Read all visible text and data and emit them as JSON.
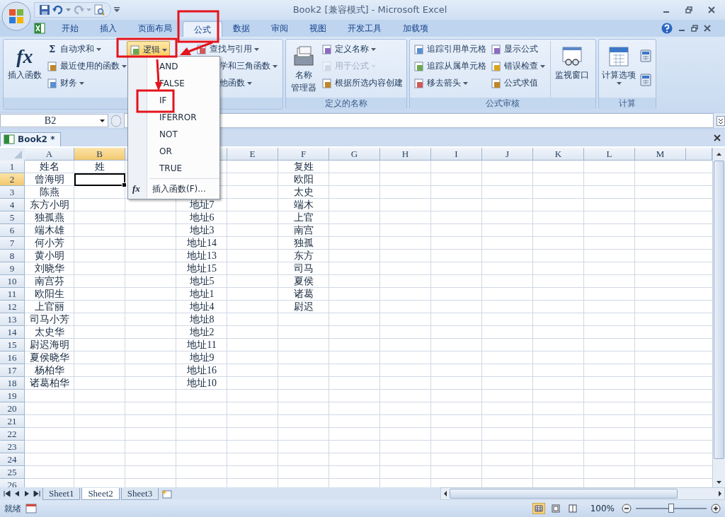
{
  "window": {
    "title": "Book2  [兼容模式] - Microsoft Excel"
  },
  "tabs": [
    {
      "label": "开始",
      "selected": false
    },
    {
      "label": "插入",
      "selected": false
    },
    {
      "label": "页面布局",
      "selected": false
    },
    {
      "label": "公式",
      "selected": true
    },
    {
      "label": "数据",
      "selected": false
    },
    {
      "label": "审阅",
      "selected": false
    },
    {
      "label": "视图",
      "selected": false
    },
    {
      "label": "开发工具",
      "selected": false
    },
    {
      "label": "加载项",
      "selected": false
    }
  ],
  "ribbon": {
    "groups": [
      {
        "columns": [
          [
            {
              "kind": "large",
              "glyph": "fx",
              "label": "插入函数",
              "dropdown": false,
              "open": false,
              "disabled": false
            }
          ],
          [
            {
              "kind": "small",
              "glyph": "Σ",
              "label": "自动求和",
              "dropdown": true,
              "open": false,
              "disabled": false
            },
            {
              "kind": "small",
              "label": "最近使用的函数",
              "dropdown": true,
              "open": false,
              "disabled": false
            },
            {
              "kind": "small",
              "label": "财务",
              "dropdown": true,
              "open": false,
              "disabled": false
            }
          ],
          [
            {
              "kind": "small",
              "label": "逻辑",
              "dropdown": true,
              "open": true,
              "disabled": false
            }
          ],
          [
            {
              "kind": "small",
              "label": "查找与引用",
              "dropdown": true,
              "open": false,
              "disabled": false
            },
            {
              "kind": "clipped",
              "label": "学和三角函数",
              "dropdown": true,
              "open": false,
              "disabled": false
            },
            {
              "kind": "clipped",
              "label": "他函数",
              "dropdown": true,
              "open": false,
              "disabled": false
            }
          ]
        ]
      },
      {
        "label": "定义的名称",
        "columns": [
          [
            {
              "kind": "large",
              "lines": [
                "名称",
                "管理器"
              ],
              "dropdown": false,
              "open": false,
              "disabled": false
            }
          ],
          [
            {
              "kind": "small",
              "label": "定义名称",
              "dropdown": true,
              "open": false,
              "disabled": false
            },
            {
              "kind": "small",
              "label": "用于公式",
              "dropdown": true,
              "open": false,
              "disabled": true
            },
            {
              "kind": "small",
              "label": "根据所选内容创建",
              "dropdown": false,
              "open": false,
              "disabled": false
            }
          ]
        ]
      },
      {
        "label": "公式审核",
        "columns": [
          [
            {
              "kind": "small",
              "label": "追踪引用单元格",
              "dropdown": false,
              "open": false,
              "disabled": false
            },
            {
              "kind": "small",
              "label": "追踪从属单元格",
              "dropdown": false,
              "open": false,
              "disabled": false
            },
            {
              "kind": "small",
              "label": "移去箭头",
              "dropdown": true,
              "open": false,
              "disabled": false
            }
          ],
          [
            {
              "kind": "small",
              "label": "显示公式",
              "dropdown": false,
              "open": false,
              "disabled": false
            },
            {
              "kind": "small",
              "label": "错误检查",
              "dropdown": true,
              "open": false,
              "disabled": false
            },
            {
              "kind": "small",
              "label": "公式求值",
              "dropdown": false,
              "open": false,
              "disabled": false
            }
          ],
          [
            {
              "kind": "large",
              "label": "监视窗口",
              "dropdown": false,
              "open": false,
              "disabled": false
            }
          ]
        ]
      },
      {
        "label": "计算",
        "columns": [
          [
            {
              "kind": "large",
              "label": "计算选项",
              "dropdown": true,
              "open": false,
              "disabled": false
            }
          ],
          [
            {
              "kind": "icon",
              "dropdown": false,
              "open": false,
              "disabled": false
            },
            {
              "kind": "icon",
              "dropdown": false,
              "open": false,
              "disabled": false
            }
          ]
        ]
      }
    ]
  },
  "menu": {
    "items": [
      {
        "kind": "function",
        "label": "AND"
      },
      {
        "kind": "function",
        "label": "FALSE"
      },
      {
        "kind": "function",
        "label": "IF"
      },
      {
        "kind": "function",
        "label": "IFERROR"
      },
      {
        "kind": "function",
        "label": "NOT"
      },
      {
        "kind": "function",
        "label": "OR"
      },
      {
        "kind": "function",
        "label": "TRUE"
      },
      {
        "kind": "command",
        "glyph": "fx",
        "label": "插入函数(F)..."
      }
    ]
  },
  "formula_bar": {
    "name_box": "B2"
  },
  "workbook_tab": {
    "label": "Book2 *"
  },
  "sheet": {
    "columns": [
      {
        "label": "A",
        "selected": false
      },
      {
        "label": "B",
        "selected": true
      },
      {
        "selected": false
      },
      {
        "selected": false
      },
      {
        "label": "E",
        "selected": false
      },
      {
        "label": "F",
        "selected": false
      },
      {
        "label": "G",
        "selected": false
      },
      {
        "label": "H",
        "selected": false
      },
      {
        "label": "I",
        "selected": false
      },
      {
        "label": "J",
        "selected": false
      },
      {
        "label": "K",
        "selected": false
      },
      {
        "label": "L",
        "selected": false
      },
      {
        "label": "M",
        "selected": false
      },
      {
        "selected": false
      }
    ],
    "rows": [
      {
        "number": "1",
        "selected": false,
        "cells": [
          "姓名",
          "姓",
          "",
          "",
          "",
          "复姓"
        ]
      },
      {
        "number": "2",
        "selected": true,
        "cells": [
          "曾海明",
          "",
          "",
          "",
          "",
          "欧阳"
        ]
      },
      {
        "number": "3",
        "selected": false,
        "cells": [
          "陈燕",
          "",
          "",
          "",
          "",
          "太史"
        ]
      },
      {
        "number": "4",
        "selected": false,
        "cells": [
          "东方小明",
          "",
          "",
          "地址7",
          "",
          "端木"
        ]
      },
      {
        "number": "5",
        "selected": false,
        "cells": [
          "独孤燕",
          "",
          "",
          "地址6",
          "",
          "上官"
        ]
      },
      {
        "number": "6",
        "selected": false,
        "cells": [
          "端木雄",
          "",
          "",
          "地址3",
          "",
          "南宫"
        ]
      },
      {
        "number": "7",
        "selected": false,
        "cells": [
          "何小芳",
          "",
          "",
          "地址14",
          "",
          "独孤"
        ]
      },
      {
        "number": "8",
        "selected": false,
        "cells": [
          "黄小明",
          "",
          "",
          "地址13",
          "",
          "东方"
        ]
      },
      {
        "number": "9",
        "selected": false,
        "cells": [
          "刘晓华",
          "",
          "",
          "地址15",
          "",
          "司马"
        ]
      },
      {
        "number": "10",
        "selected": false,
        "cells": [
          "南宫芬",
          "",
          "",
          "地址5",
          "",
          "夏侯"
        ]
      },
      {
        "number": "11",
        "selected": false,
        "cells": [
          "欧阳生",
          "",
          "",
          "地址1",
          "",
          "诸葛"
        ]
      },
      {
        "number": "12",
        "selected": false,
        "cells": [
          "上官丽",
          "",
          "",
          "地址4",
          "",
          "尉迟"
        ]
      },
      {
        "number": "13",
        "selected": false,
        "cells": [
          "司马小芳",
          "",
          "",
          "地址8"
        ]
      },
      {
        "number": "14",
        "selected": false,
        "cells": [
          "太史华",
          "",
          "",
          "地址2"
        ]
      },
      {
        "number": "15",
        "selected": false,
        "cells": [
          "尉迟海明",
          "",
          "",
          "地址11"
        ]
      },
      {
        "number": "16",
        "selected": false,
        "cells": [
          "夏侯晓华",
          "",
          "",
          "地址9"
        ]
      },
      {
        "number": "17",
        "selected": false,
        "cells": [
          "杨柏华",
          "",
          "",
          "地址16"
        ]
      },
      {
        "number": "18",
        "selected": false,
        "cells": [
          "诸葛柏华",
          "",
          "",
          "地址10"
        ]
      },
      {
        "number": "19",
        "selected": false
      },
      {
        "number": "20",
        "selected": false
      },
      {
        "number": "21",
        "selected": false
      },
      {
        "number": "22",
        "selected": false
      },
      {
        "number": "23",
        "selected": false
      },
      {
        "number": "24",
        "selected": false
      },
      {
        "number": "25",
        "selected": false
      },
      {
        "number": "26",
        "selected": false
      }
    ]
  },
  "sheet_tabs": [
    {
      "label": "Sheet1",
      "selected": false
    },
    {
      "label": "Sheet2",
      "selected": true
    },
    {
      "label": "Sheet3",
      "selected": false
    }
  ],
  "status_bar": {
    "text": "就绪",
    "views": [
      {
        "selected": true
      },
      {
        "selected": false
      },
      {
        "selected": false
      }
    ],
    "zoom": "100%",
    "zoom_slider": {
      "level": 0.5
    }
  }
}
